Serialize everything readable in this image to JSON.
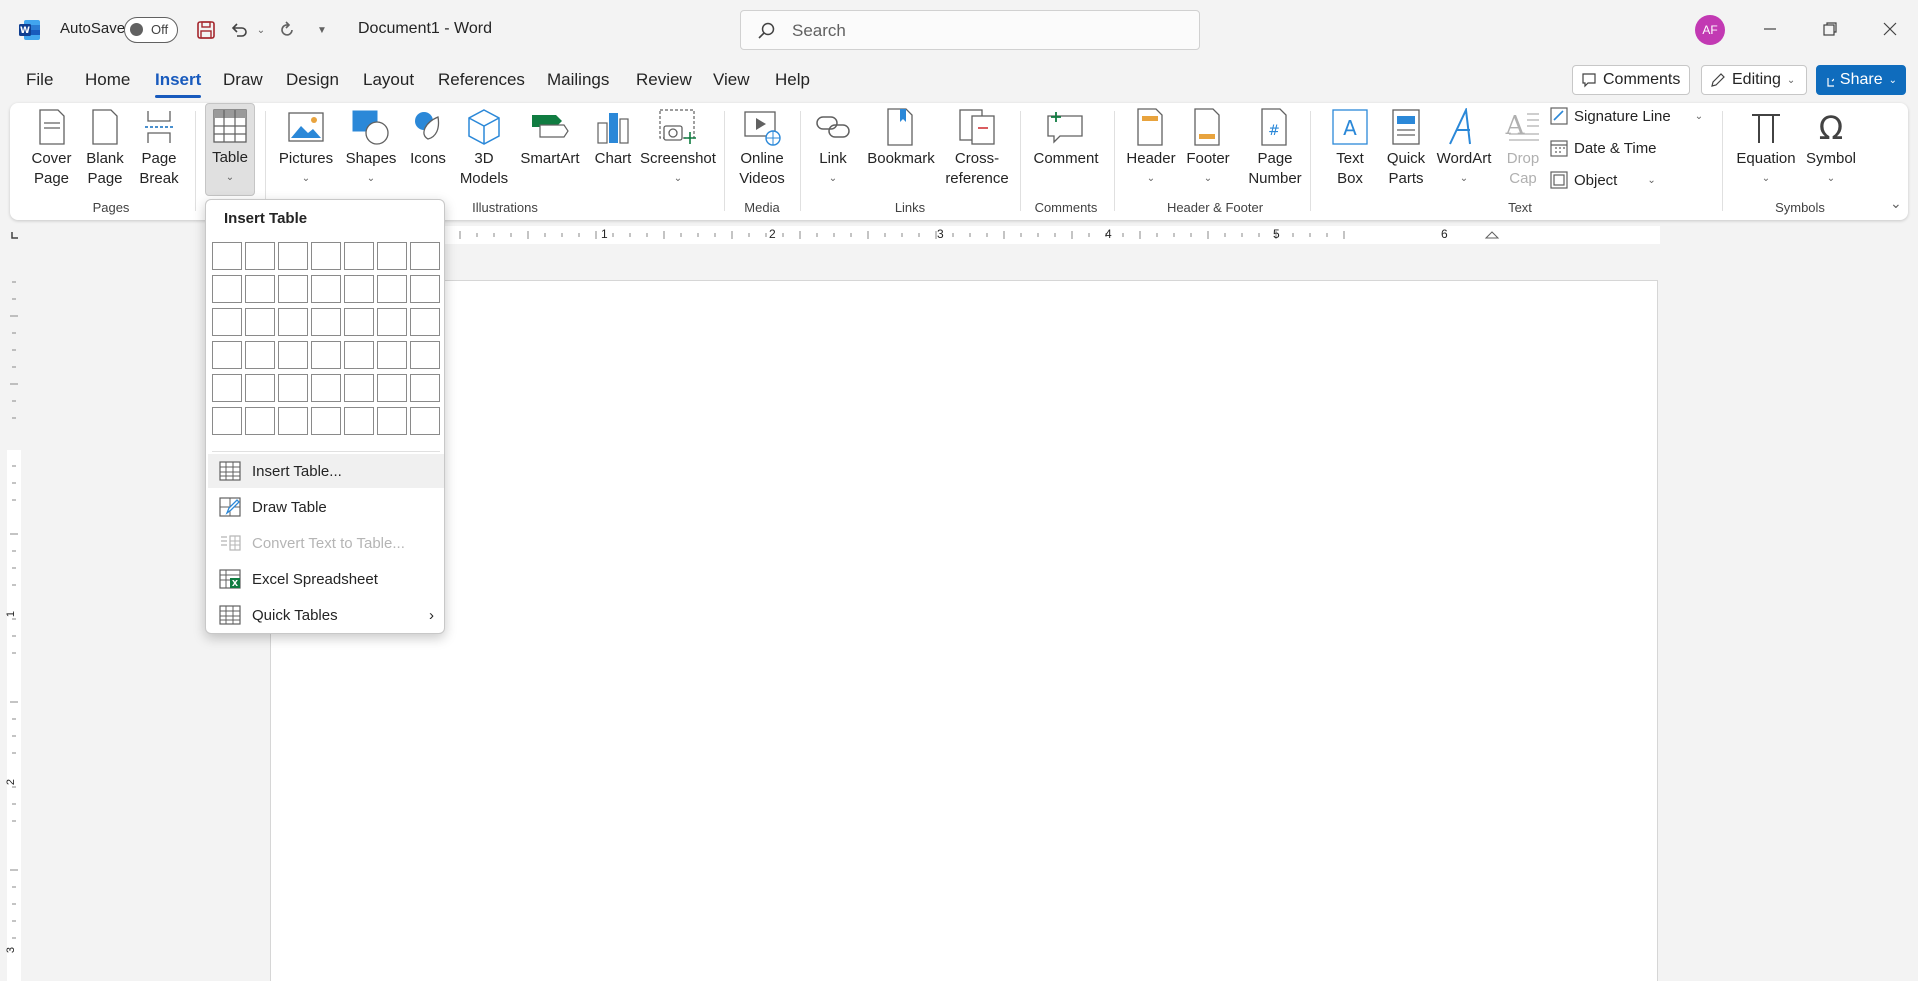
{
  "titlebar": {
    "autosave_label": "AutoSave",
    "autosave_state": "Off",
    "document_title": "Document1  -  Word",
    "search_placeholder": "Search",
    "avatar_initials": "AF"
  },
  "menu_tabs": [
    "File",
    "Home",
    "Insert",
    "Draw",
    "Design",
    "Layout",
    "References",
    "Mailings",
    "Review",
    "View",
    "Help"
  ],
  "active_tab": "Insert",
  "top_right": {
    "comments": "Comments",
    "editing": "Editing",
    "share": "Share"
  },
  "ribbon": {
    "pages": {
      "label": "Pages",
      "items": [
        "Cover\nPage",
        "Blank\nPage",
        "Page\nBreak"
      ]
    },
    "tables": {
      "items": [
        "Table"
      ]
    },
    "illustrations": {
      "label": "Illustrations",
      "items": [
        "Pictures",
        "Shapes",
        "Icons",
        "3D\nModels",
        "SmartArt",
        "Chart",
        "Screenshot"
      ]
    },
    "media": {
      "label": "Media",
      "items": [
        "Online\nVideos"
      ]
    },
    "links": {
      "label": "Links",
      "items": [
        "Link",
        "Bookmark",
        "Cross-\nreference"
      ]
    },
    "comments": {
      "label": "Comments",
      "items": [
        "Comment"
      ]
    },
    "header_footer": {
      "label": "Header & Footer",
      "items": [
        "Header",
        "Footer",
        "Page\nNumber"
      ]
    },
    "text": {
      "label": "Text",
      "items": [
        "Text\nBox",
        "Quick\nParts",
        "WordArt",
        "Drop\nCap"
      ],
      "small": [
        "Signature Line",
        "Date & Time",
        "Object"
      ]
    },
    "symbols": {
      "label": "Symbols",
      "items": [
        "Equation",
        "Symbol"
      ]
    }
  },
  "ruler_numbers": [
    "1",
    "2",
    "3",
    "4",
    "5",
    "6"
  ],
  "vruler_numbers": [
    "1",
    "2",
    "3"
  ],
  "insert_table_menu": {
    "title": "Insert Table",
    "grid_cols": 7,
    "grid_rows": 6,
    "items": [
      {
        "label": "Insert Table...",
        "icon": "table-icon",
        "state": "hover"
      },
      {
        "label": "Draw Table",
        "icon": "draw-table-icon",
        "state": "normal"
      },
      {
        "label": "Convert Text to Table...",
        "icon": "convert-icon",
        "state": "disabled"
      },
      {
        "label": "Excel Spreadsheet",
        "icon": "excel-icon",
        "state": "normal"
      },
      {
        "label": "Quick Tables",
        "icon": "quick-tables-icon",
        "state": "normal",
        "submenu": true
      }
    ]
  },
  "colors": {
    "accent": "#185abd",
    "share": "#0f6cbd",
    "avatar": "#c239b3"
  }
}
